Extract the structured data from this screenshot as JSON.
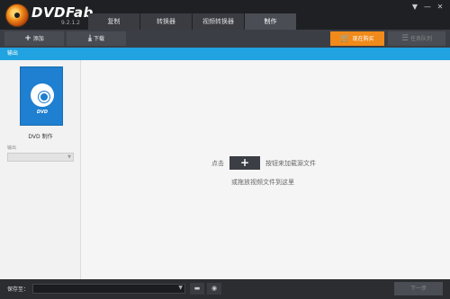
{
  "app": {
    "brand": "DVDFab",
    "version": "9.2.1.2"
  },
  "tabs": [
    {
      "label": "复制"
    },
    {
      "label": "转换器"
    },
    {
      "label": "视频转换器"
    },
    {
      "label": "制作",
      "active": true
    }
  ],
  "window_controls": {
    "menu": "▼",
    "minimize": "—",
    "close": "✕"
  },
  "toolbar": {
    "add_label": "添加",
    "download_label": "下载",
    "buy_label": "现在购买",
    "queue_label": "任务队列"
  },
  "output_strip": {
    "label": "输出"
  },
  "left_panel": {
    "dvd_disc_text": "DVD",
    "dvd_label": "DVD 制作",
    "output_label": "输出",
    "output_value": ""
  },
  "main": {
    "hint_prefix": "点击",
    "plus_symbol": "+",
    "hint_suffix": "按钮来加载源文件",
    "hint_line2": "或拖放视频文件到这里"
  },
  "bottom": {
    "save_to_label": "保存至：",
    "save_path": "",
    "next_label": "下一步"
  },
  "colors": {
    "accent_blue": "#20a3e0",
    "buy_orange": "#f08a1a",
    "dvd_tile_blue": "#1f7fd0"
  }
}
